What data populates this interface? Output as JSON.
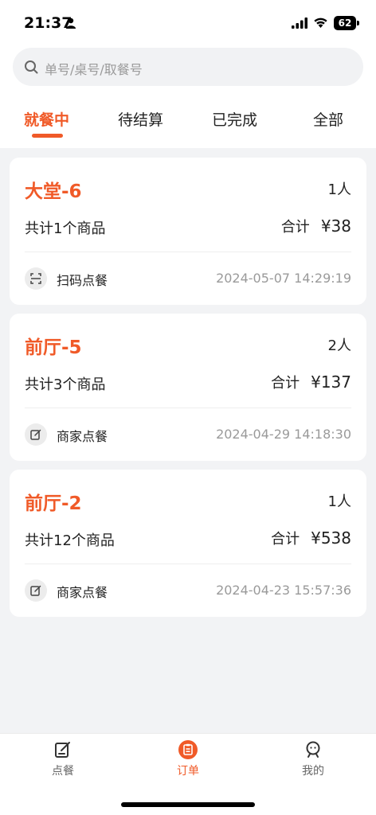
{
  "status": {
    "time": "21:37",
    "battery": "62"
  },
  "search": {
    "placeholder": "单号/桌号/取餐号"
  },
  "tabs": [
    {
      "label": "就餐中",
      "active": true
    },
    {
      "label": "待结算",
      "active": false
    },
    {
      "label": "已完成",
      "active": false
    },
    {
      "label": "全部",
      "active": false
    }
  ],
  "orders": [
    {
      "table": "大堂-6",
      "people": "1人",
      "count": "共计1个商品",
      "total_label": "合计",
      "total": "¥38",
      "order_type": "扫码点餐",
      "order_type_icon": "scan-icon",
      "time": "2024-05-07 14:29:19"
    },
    {
      "table": "前厅-5",
      "people": "2人",
      "count": "共计3个商品",
      "total_label": "合计",
      "total": "¥137",
      "order_type": "商家点餐",
      "order_type_icon": "edit-icon",
      "time": "2024-04-29 14:18:30"
    },
    {
      "table": "前厅-2",
      "people": "1人",
      "count": "共计12个商品",
      "total_label": "合计",
      "total": "¥538",
      "order_type": "商家点餐",
      "order_type_icon": "edit-icon",
      "time": "2024-04-23 15:57:36"
    }
  ],
  "bottom_nav": [
    {
      "label": "点餐",
      "icon": "edit-icon",
      "active": false
    },
    {
      "label": "订单",
      "icon": "clipboard-icon",
      "active": true
    },
    {
      "label": "我的",
      "icon": "user-icon",
      "active": false
    }
  ],
  "colors": {
    "accent": "#f05a28",
    "background": "#f2f3f5",
    "muted": "#9a9a9a"
  }
}
